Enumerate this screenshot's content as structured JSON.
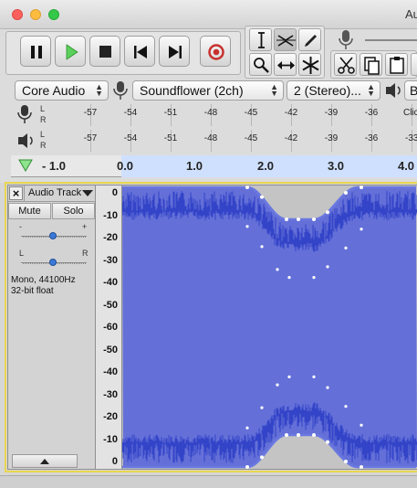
{
  "window": {
    "title": "Au"
  },
  "transport": {
    "pause": "Pause",
    "play": "Play",
    "stop": "Stop",
    "skip_start": "Skip to Start",
    "skip_end": "Skip to End",
    "record": "Record"
  },
  "tools": [
    "selection-tool",
    "envelope-tool",
    "draw-tool",
    "zoom-tool",
    "time-shift-tool",
    "multi-tool"
  ],
  "devices": {
    "host": "Core Audio",
    "recording_device": "Soundflower (2ch)",
    "channels": "2 (Stereo)...",
    "playback_partial": "B"
  },
  "meters": {
    "record_ticks": [
      "-57",
      "-54",
      "-51",
      "-48",
      "-45",
      "-42",
      "-39",
      "-36",
      "Clic"
    ],
    "play_ticks": [
      "-57",
      "-54",
      "-51",
      "-48",
      "-45",
      "-42",
      "-39",
      "-36",
      "-33"
    ],
    "channel_labels": [
      "L",
      "R"
    ]
  },
  "timeline": {
    "labels": [
      "- 1.0",
      "0.0",
      "1.0",
      "2.0",
      "3.0",
      "4.0"
    ]
  },
  "track": {
    "name": "Audio Track",
    "close": "×",
    "mute": "Mute",
    "solo": "Solo",
    "gain_minus": "-",
    "gain_plus": "+",
    "pan_left": "L",
    "pan_right": "R",
    "gain_level": 0.5,
    "pan_level": 0.5,
    "info_line1": "Mono, 44100Hz",
    "info_line2": "32-bit float"
  },
  "amplitude_scale": [
    "0",
    "-10",
    "-20",
    "-30",
    "-40",
    "-50",
    "-60",
    "-50",
    "-40",
    "-30",
    "-20",
    "-10",
    "0"
  ],
  "colors": {
    "waveform_bg": "#6470d8",
    "waveform": "#3344c8",
    "envelope_bg": "#c4c4c4",
    "envelope_line": "#6a78e0",
    "selection_band": "#cfe0ff",
    "track_highlight": "#e8d650"
  }
}
